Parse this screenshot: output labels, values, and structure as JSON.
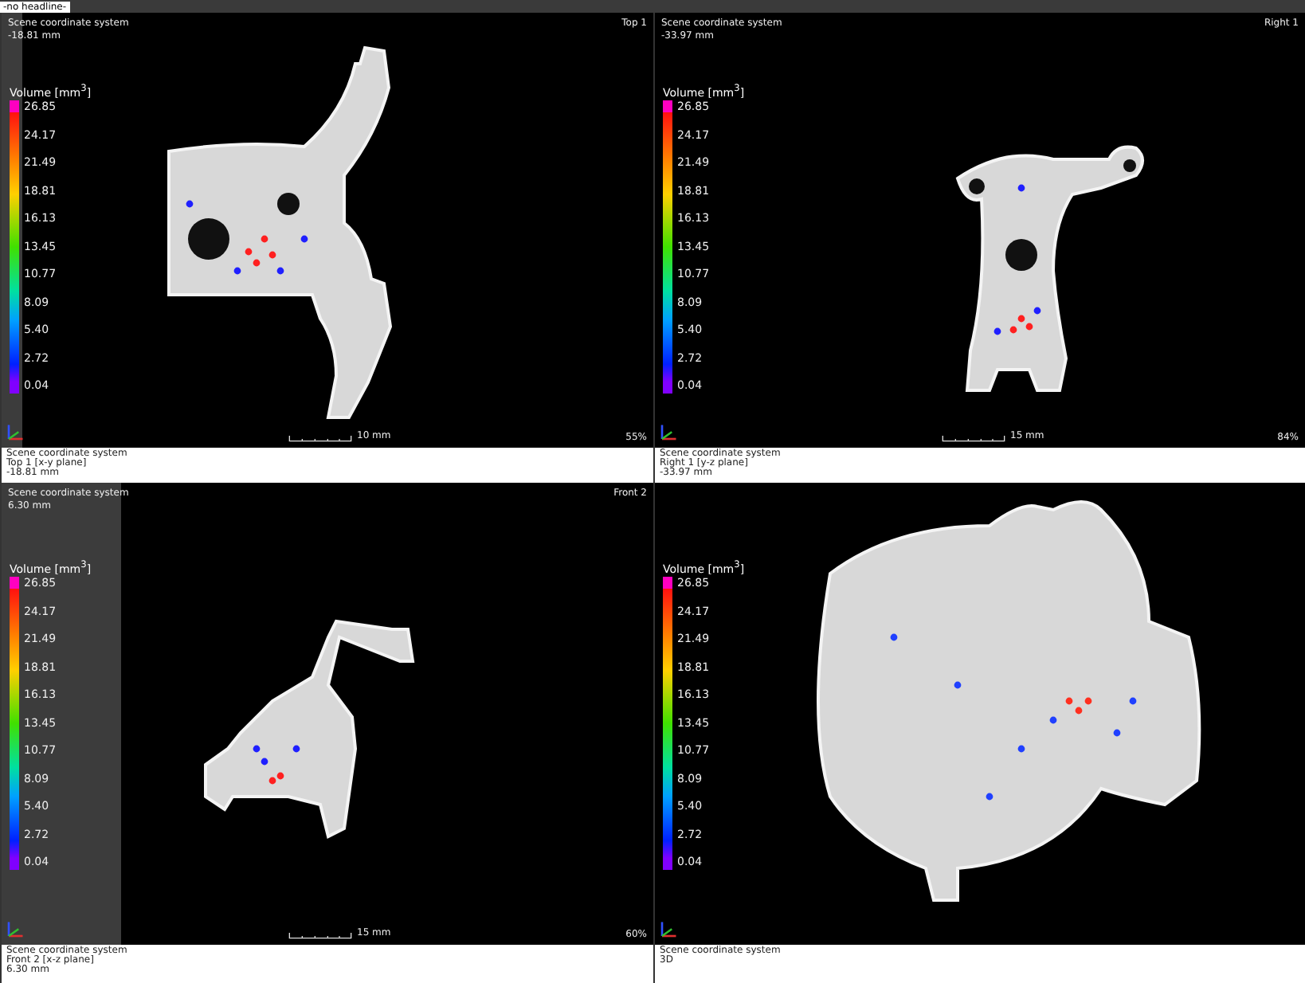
{
  "header": {
    "title": "-no headline-"
  },
  "panels": [
    {
      "kind": "bracket",
      "view_label": "Top 1",
      "coord_system": "Scene coordinate system",
      "depth": "-18.81 mm",
      "legend": {
        "title": "Volume [mm$^{3}$]",
        "ticks": [
          "26.85",
          "24.17",
          "21.49",
          "18.81",
          "16.13",
          "13.45",
          "10.77",
          "8.09",
          "5.40",
          "2.72",
          "0.04"
        ]
      },
      "scale_label": "10 mm",
      "zoom": "55%",
      "info": [
        "Scene coordinate system",
        "Top 1 [x-y plane]",
        "-18.81 mm"
      ]
    },
    {
      "kind": "frame",
      "view_label": "Right 1",
      "coord_system": "Scene coordinate system",
      "depth": "-33.97 mm",
      "legend": {
        "title": "Volume [mm$^{3}$]",
        "ticks": [
          "26.85",
          "24.17",
          "21.49",
          "18.81",
          "16.13",
          "13.45",
          "10.77",
          "8.09",
          "5.40",
          "2.72",
          "0.04"
        ]
      },
      "scale_label": "15 mm",
      "zoom": "84%",
      "info": [
        "Scene coordinate system",
        "Right 1 [y-z plane]",
        "-33.97 mm"
      ]
    },
    {
      "kind": "lever",
      "view_label": "Front 2",
      "coord_system": "Scene coordinate system",
      "depth": "6.30 mm",
      "legend": {
        "title": "Volume [mm$^{3}$]",
        "ticks": [
          "26.85",
          "24.17",
          "21.49",
          "18.81",
          "16.13",
          "13.45",
          "10.77",
          "8.09",
          "5.40",
          "2.72",
          "0.04"
        ]
      },
      "scale_label": "15 mm",
      "zoom": "60%",
      "info": [
        "Scene coordinate system",
        "Front 2 [x-z plane]",
        "6.30 mm"
      ]
    },
    {
      "kind": "housing",
      "legend": {
        "title": "Volume [mm$^{3}$]",
        "ticks": [
          "26.85",
          "24.17",
          "21.49",
          "18.81",
          "16.13",
          "13.45",
          "10.77",
          "8.09",
          "5.40",
          "2.72",
          "0.04"
        ]
      },
      "info": [
        "Scene coordinate system",
        "3D"
      ]
    }
  ]
}
